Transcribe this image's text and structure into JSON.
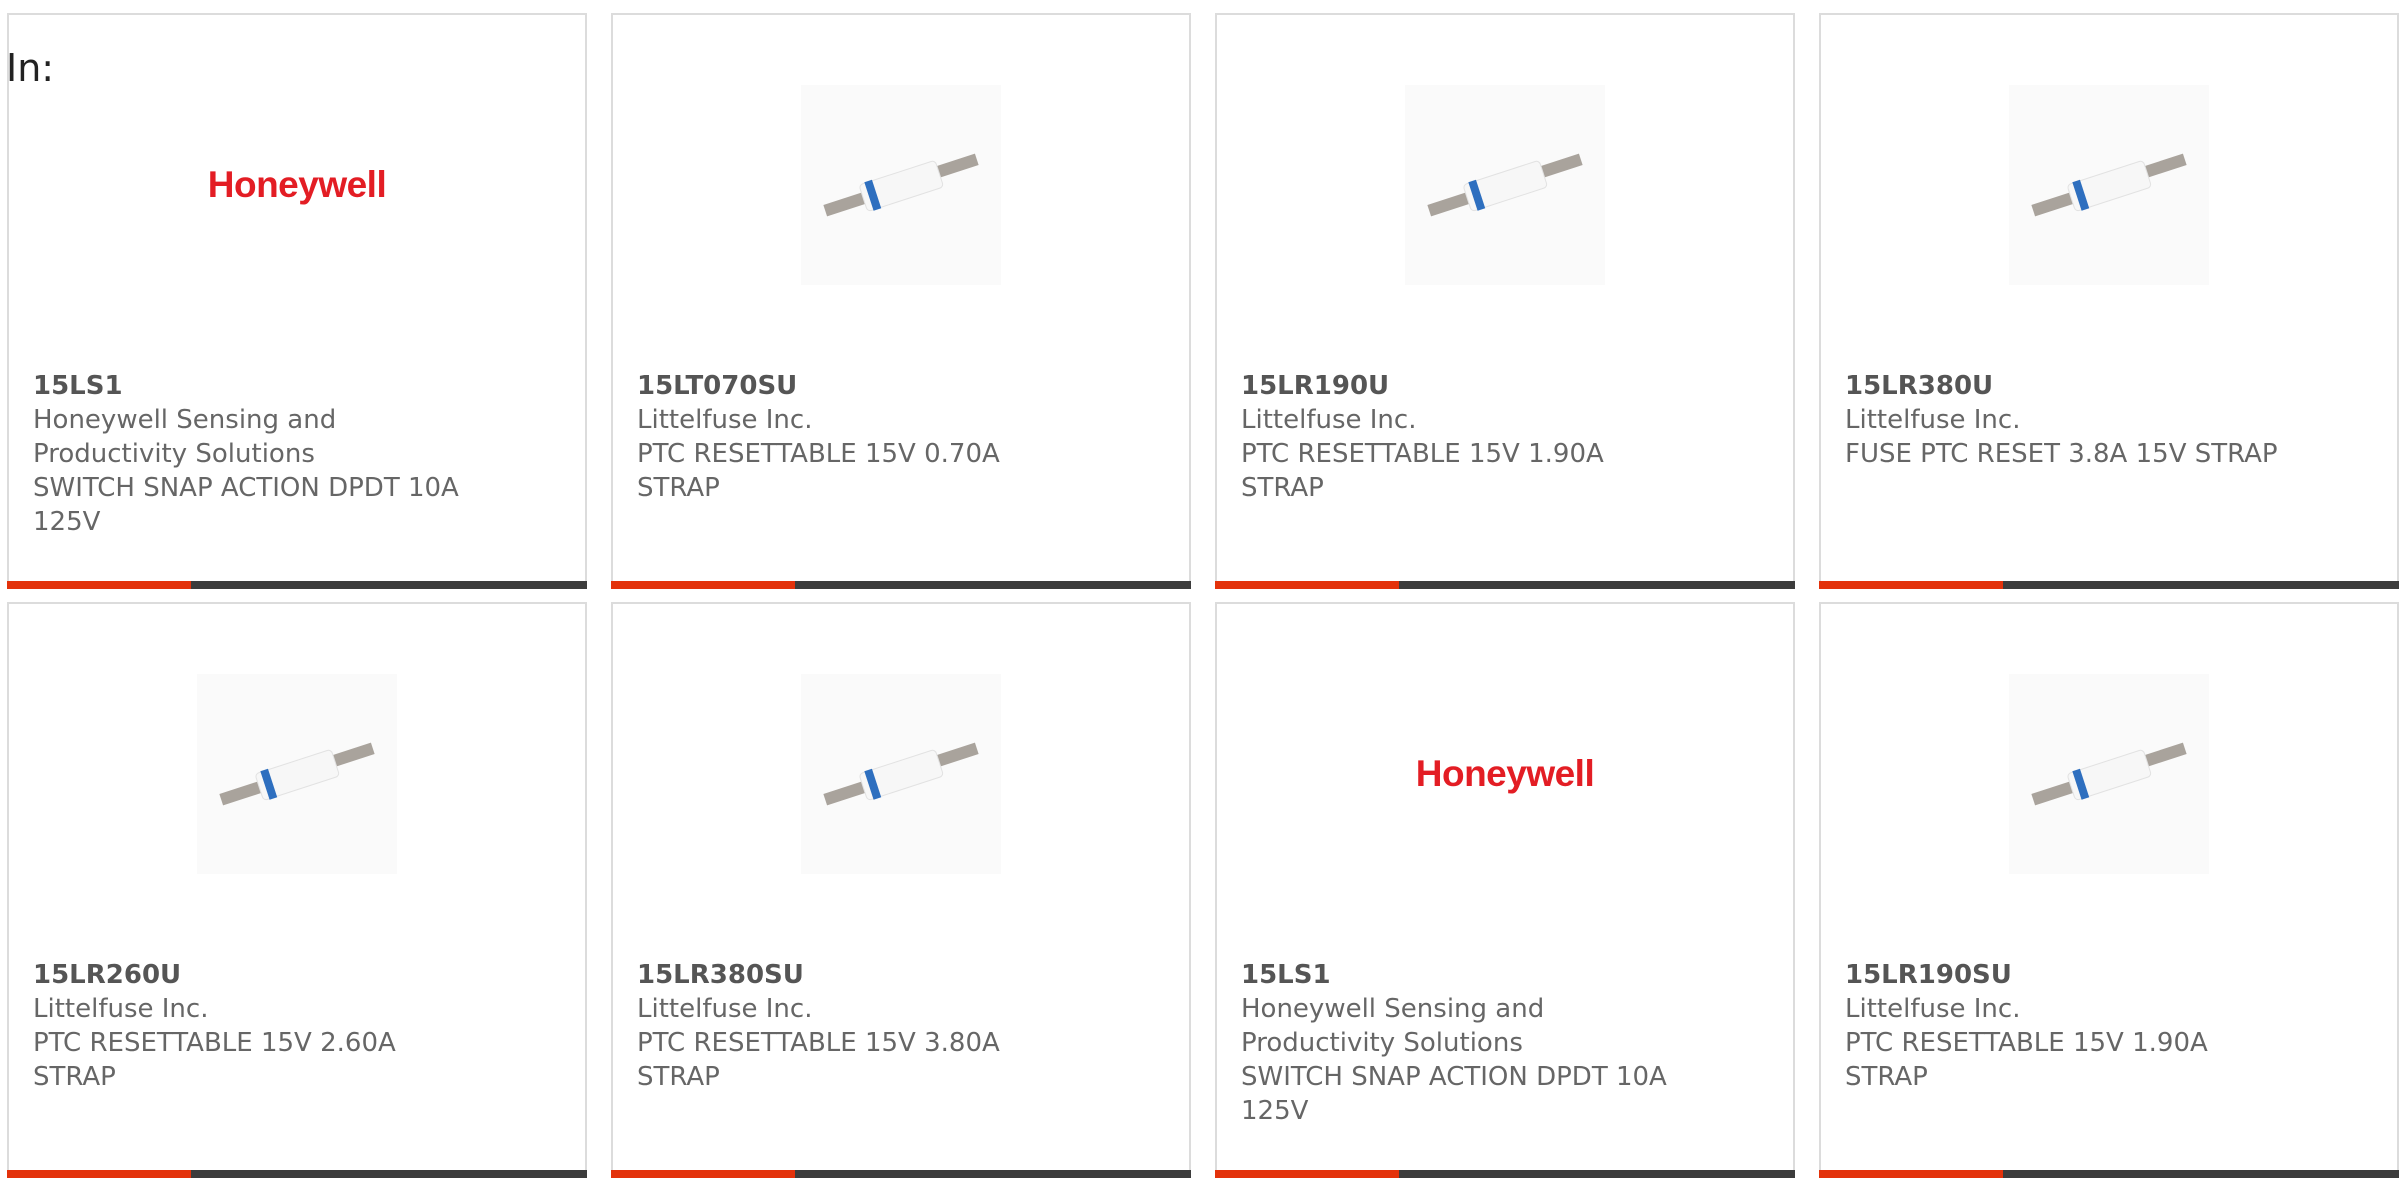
{
  "header": {
    "in_label": "In:"
  },
  "colors": {
    "accent": "#e3320b",
    "bar_dark": "#3c3c3c",
    "brand_red": "#e31d24"
  },
  "cards": [
    {
      "image": "logo",
      "logo_text": "Honeywell",
      "part_number": "15LS1",
      "manufacturer": "Honeywell Sensing and Productivity Solutions",
      "description": "SWITCH SNAP ACTION DPDT 10A 125V"
    },
    {
      "image": "ptc-strap-photo",
      "part_number": "15LT070SU",
      "manufacturer": "Littelfuse Inc.",
      "description": "PTC RESETTABLE 15V 0.70A STRAP"
    },
    {
      "image": "ptc-strap-photo",
      "part_number": "15LR190U",
      "manufacturer": "Littelfuse Inc.",
      "description": "PTC RESETTABLE 15V 1.90A STRAP"
    },
    {
      "image": "ptc-strap-photo",
      "part_number": "15LR380U",
      "manufacturer": "Littelfuse Inc.",
      "description": "FUSE PTC RESET 3.8A 15V STRAP"
    },
    {
      "image": "ptc-strap-photo",
      "part_number": "15LR260U",
      "manufacturer": "Littelfuse Inc.",
      "description": "PTC RESETTABLE 15V 2.60A STRAP"
    },
    {
      "image": "ptc-strap-photo",
      "part_number": "15LR380SU",
      "manufacturer": "Littelfuse Inc.",
      "description": "PTC RESETTABLE 15V 3.80A STRAP"
    },
    {
      "image": "logo",
      "logo_text": "Honeywell",
      "part_number": "15LS1",
      "manufacturer": "Honeywell Sensing and Productivity Solutions",
      "description": "SWITCH SNAP ACTION DPDT 10A 125V"
    },
    {
      "image": "ptc-strap-photo",
      "part_number": "15LR190SU",
      "manufacturer": "Littelfuse Inc.",
      "description": "PTC RESETTABLE 15V 1.90A STRAP"
    }
  ]
}
